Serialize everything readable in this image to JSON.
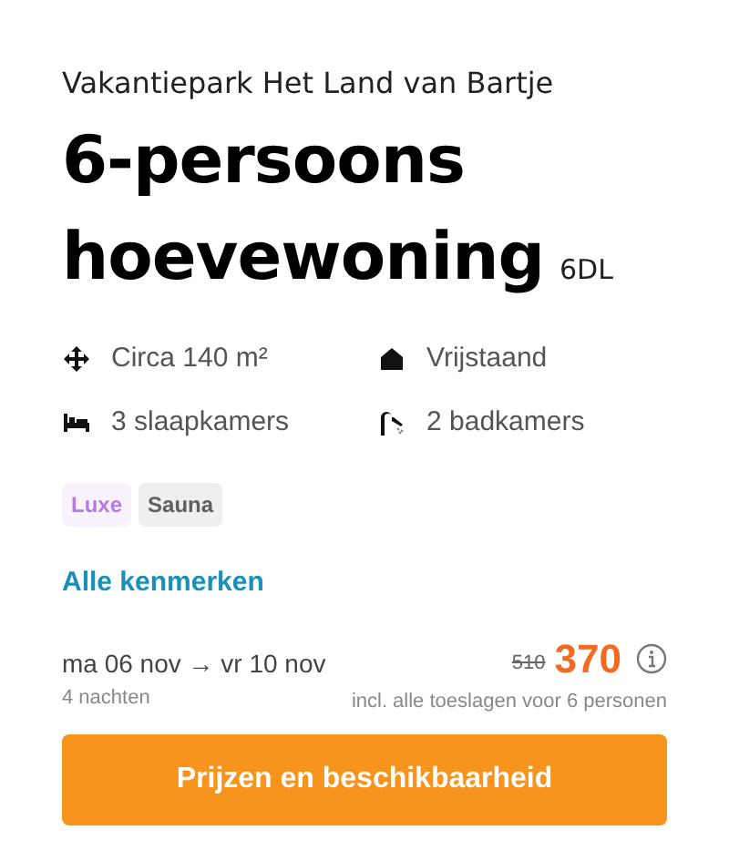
{
  "park": "Vakantiepark Het Land van Bartje",
  "title": "6-persoons hoevewoning",
  "code": "6DL",
  "features": [
    {
      "kind": "area",
      "label": "Circa 140 m²"
    },
    {
      "kind": "house",
      "label": "Vrijstaand"
    },
    {
      "kind": "bed",
      "label": "3 slaapkamers"
    },
    {
      "kind": "shower",
      "label": "2 badkamers"
    }
  ],
  "tags": [
    {
      "label": "Luxe",
      "color": "#b57be0"
    },
    {
      "label": "Sauna",
      "color": "#5f5f5f"
    }
  ],
  "link": "Alle kenmerken",
  "dates": "ma 06 nov → vr 10 nov",
  "nights": "4 nachten",
  "old_price": "510",
  "price": "370",
  "price_note": "incl. alle toeslagen voor 6 personen",
  "button": "Prijzen en beschikbaarheid"
}
